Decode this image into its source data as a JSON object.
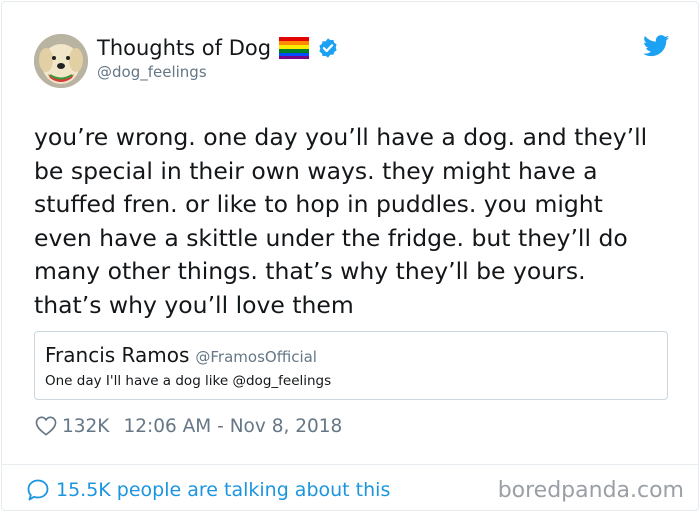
{
  "author": {
    "display_name": "Thoughts of Dog",
    "handle": "@dog_feelings",
    "verified": true,
    "flag": "rainbow-flag-emoji"
  },
  "tweet": {
    "text": "you’re wrong. one day you’ll have a dog. and they’ll\nbe special in their own ways. they might have a\nstuffed fren. or like to hop in puddles. you might\neven have a skittle under the fridge. but they’ll do\nmany other things. that’s why they’ll be yours.\nthat’s why you’ll love them"
  },
  "quoted_tweet": {
    "name": "Francis Ramos",
    "handle": "@FramosOfficial",
    "text": "One day I'll have a dog like @dog_feelings"
  },
  "meta": {
    "likes": "132K",
    "timestamp": "12:06 AM - Nov 8, 2018"
  },
  "footer": {
    "conversation": "15.5K people are talking about this"
  },
  "watermark": "boredpanda.com",
  "colors": {
    "twitter_blue": "#1da1f2",
    "link_blue": "#1b95e0",
    "secondary_text": "#657786"
  }
}
